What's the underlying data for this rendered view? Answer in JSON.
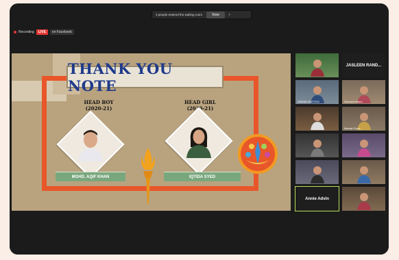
{
  "topbar": {
    "recording_label": "Recording",
    "live_badge": "LIVE",
    "platform_label": "on Facebook",
    "waiting_room_text": "3 people entered the waiting room",
    "view_button": "View",
    "close_icon": "close-icon"
  },
  "slide": {
    "title": "THANK YOU NOTE",
    "head_boy": {
      "role": "HEAD BOY",
      "year": "(2020-21)",
      "name": "MOHD. AQIF KHAN"
    },
    "head_girl": {
      "role": "HEAD GIRL",
      "year": "(2020-21)",
      "name": "IQTIDA SYED"
    },
    "colors": {
      "frame": "#e8562a",
      "title": "#1f3a8a",
      "nameplate": "#79a77d",
      "background": "#b9a37f"
    }
  },
  "participants": [
    {
      "name": "",
      "type": "video"
    },
    {
      "name": "JASLEEN RAND...",
      "type": "name-only"
    },
    {
      "name": "ARNNE MATTOO",
      "type": "video"
    },
    {
      "name": "Gurmeet Mann",
      "type": "video"
    },
    {
      "name": "",
      "type": "video"
    },
    {
      "name": "Mamta Chou...",
      "type": "video"
    },
    {
      "name": "",
      "type": "video"
    },
    {
      "name": "",
      "type": "video"
    },
    {
      "name": "",
      "type": "video"
    },
    {
      "name": "",
      "type": "video"
    },
    {
      "name": "Annie Advin",
      "type": "name-only",
      "active": true
    },
    {
      "name": "",
      "type": "video"
    }
  ]
}
